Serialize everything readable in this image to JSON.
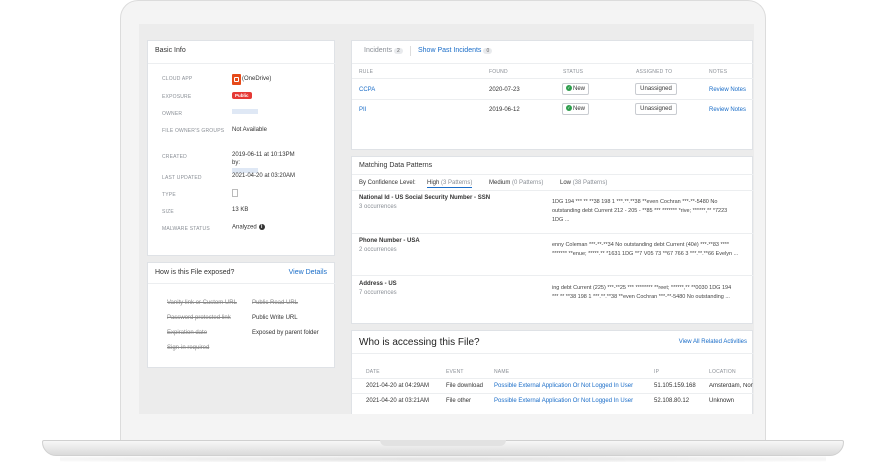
{
  "basic_info": {
    "title": "Basic Info",
    "rows": [
      {
        "label": "CLOUD APP",
        "value": "(OneDrive)"
      },
      {
        "label": "EXPOSURE",
        "value": "Public"
      },
      {
        "label": "OWNER",
        "value": ""
      },
      {
        "label": "FILE OWNER'S GROUPS",
        "value": "Not Available"
      },
      {
        "label": "CREATED",
        "value": "2019-06-11 at 10:13PM",
        "value2": "by:"
      },
      {
        "label": "LAST UPDATED",
        "value": "2021-04-20 at 03:20AM"
      },
      {
        "label": "TYPE",
        "value": ""
      },
      {
        "label": "SIZE",
        "value": "13 KB"
      },
      {
        "label": "MALWARE STATUS",
        "value": "Analyzed"
      }
    ]
  },
  "exposure": {
    "title": "How is this File exposed?",
    "view_details": "View Details",
    "items": [
      {
        "left": "Vanity link or Custom URL",
        "right": "Public Read URL"
      },
      {
        "left": "Password protected link",
        "right": "Public Write URL"
      },
      {
        "left": "Expiration date",
        "right": "Exposed by parent folder"
      },
      {
        "left": "Sign-in required",
        "right": ""
      }
    ]
  },
  "incidents": {
    "tab_incidents": "Incidents",
    "tab_incidents_count": "2",
    "tab_past": "Show Past Incidents",
    "tab_past_count": "0",
    "columns": [
      "RULE",
      "FOUND",
      "STATUS",
      "ASSIGNED TO",
      "NOTES"
    ],
    "rows": [
      {
        "rule": "CCPA",
        "found": "2020-07-23",
        "status": "New",
        "assigned": "Unassigned",
        "notes": "Review Notes"
      },
      {
        "rule": "PII",
        "found": "2019-06-12",
        "status": "New",
        "assigned": "Unassigned",
        "notes": "Review Notes"
      }
    ]
  },
  "patterns": {
    "title": "Matching Data Patterns",
    "by_label": "By Confidence Level:",
    "tabs": [
      {
        "label": "High",
        "count": "(3 Patterns)"
      },
      {
        "label": "Medium",
        "count": "(0 Patterns)"
      },
      {
        "label": "Low",
        "count": "(38 Patterns)"
      }
    ],
    "rows": [
      {
        "name": "National Id - US Social Security Number - SSN",
        "occ": "3 occurrences",
        "snippet1": "1DG 194 *** ** **38 198 1 ***.**.**38 **even Cochran ***-**-5480 No",
        "snippet2": "outstanding debt Current 212 - 205 - **85 *** ******* *rive; ******,** *7223",
        "snippet3": "1DG ..."
      },
      {
        "name": "Phone Number - USA",
        "occ": "2 occurrences",
        "snippet1": "enny Coleman ***-**-**34 No outstanding debt Current (40é) ***-**83 ****",
        "snippet2": "******* **enue; *****.** *1631 1DG **7 V05 73 **67 766 3 ***.**.**66 Evelyn ...",
        "snippet3": ""
      },
      {
        "name": "Address - US",
        "occ": "7 occurrences",
        "snippet1": "ing debt Current (225) ***-**25 *** ******** **reet; ******,** **0030 1DG 194",
        "snippet2": "*** ** **38 198 1 ***.**.**38 **even Cochran ***-**-5480 No outstanding ...",
        "snippet3": ""
      }
    ]
  },
  "access": {
    "title": "Who is accessing this File?",
    "view_all": "View All Related Activities",
    "columns": [
      "DATE",
      "EVENT",
      "NAME",
      "IP",
      "LOCATION"
    ],
    "rows": [
      {
        "date": "2021-04-20 at 04:29AM",
        "event": "File download",
        "name": "Possible External Application Or Not Logged In User",
        "ip": "51.105.159.168",
        "location": "Amsterdam, Nort"
      },
      {
        "date": "2021-04-20 at 03:21AM",
        "event": "File other",
        "name": "Possible External Application Or Not Logged In User",
        "ip": "52.108.80.12",
        "location": "Unknown"
      }
    ]
  },
  "colors": {
    "accent": "#1a6dc8",
    "public_badge": "#e53935",
    "status_green": "#2e9d4c"
  }
}
